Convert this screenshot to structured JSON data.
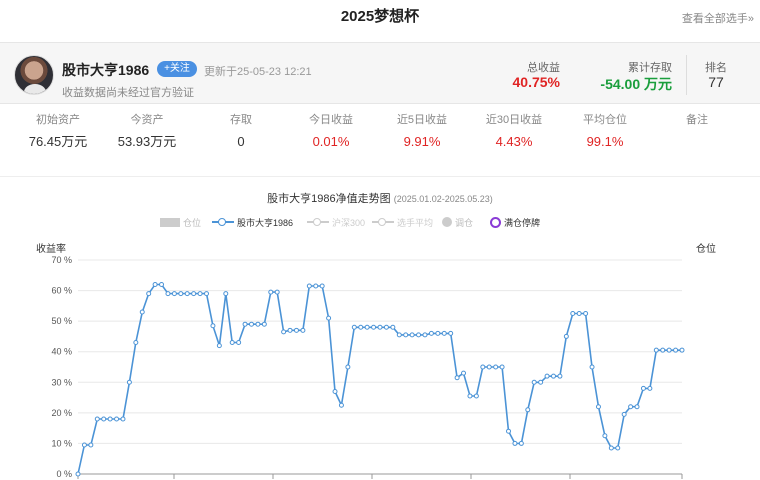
{
  "page": {
    "title": "2025梦想杯",
    "view_all": "查看全部选手»"
  },
  "profile": {
    "name": "股市大亨1986",
    "follow_label": "+关注",
    "updated": "更新于25-05-23 12:21",
    "note": "收益数据尚未经过官方验证",
    "total_return_label": "总收益",
    "total_return_value": "40.75%",
    "cumulative_label": "累计存取",
    "cumulative_value": "-54.00 万元",
    "rank_label": "排名",
    "rank_value": "77"
  },
  "metrics": [
    {
      "label": "初始资产",
      "value": "76.45万元"
    },
    {
      "label": "今资产",
      "value": "53.93万元"
    },
    {
      "label": "存取",
      "value": "0"
    },
    {
      "label": "今日收益",
      "value": "0.01%"
    },
    {
      "label": "近5日收益",
      "value": "9.91%"
    },
    {
      "label": "近30日收益",
      "value": "4.43%"
    },
    {
      "label": "平均仓位",
      "value": "99.1%"
    },
    {
      "label": "备注",
      "value": ""
    }
  ],
  "colors": {
    "accent_blue": "#4a90e2",
    "line_blue": "#4b93d6",
    "positive_red": "#e02424",
    "negative_green": "#1a9e3c",
    "legend_ring": "#8a3bd6"
  },
  "chart_data": {
    "type": "line",
    "title": "股市大亨1986净值走势图",
    "date_range": "(2025.01.02-2025.05.23)",
    "ylabel": "收益率",
    "y2label": "仓位",
    "ylim": [
      0,
      70
    ],
    "yticks": [
      "0 %",
      "10 %",
      "20 %",
      "30 %",
      "40 %",
      "50 %",
      "60 %",
      "70 %"
    ],
    "legend": [
      {
        "label": "仓位",
        "icon": "box-swatch",
        "active": false
      },
      {
        "label": "股市大亨1986",
        "icon": "line-dot-swatch",
        "active": true
      },
      {
        "label": "沪深300",
        "icon": "line-dot-swatch",
        "active": false
      },
      {
        "label": "选手平均",
        "icon": "line-dot-swatch",
        "active": false
      },
      {
        "label": "调仓",
        "icon": "dot-swatch",
        "active": false
      },
      {
        "label": "满仓停牌",
        "icon": "ring-swatch",
        "active": true
      }
    ],
    "series": [
      {
        "name": "股市大亨1986",
        "values": [
          0,
          9.5,
          9.5,
          18,
          18,
          18,
          18,
          18,
          30,
          43,
          53,
          59,
          62,
          62,
          59,
          59,
          59,
          59,
          59,
          59,
          59,
          48.5,
          42,
          59,
          43,
          43,
          49,
          49,
          49,
          49,
          59.5,
          59.5,
          46.5,
          47,
          47,
          47,
          61.5,
          61.5,
          61.5,
          51,
          27,
          22.5,
          35,
          48,
          48,
          48,
          48,
          48,
          48,
          48,
          45.5,
          45.5,
          45.5,
          45.5,
          45.5,
          46,
          46,
          46,
          46,
          31.5,
          33,
          25.5,
          25.5,
          35,
          35,
          35,
          35,
          14,
          10,
          10,
          21,
          30,
          30,
          32,
          32,
          32,
          45,
          52.5,
          52.5,
          52.5,
          35,
          22,
          12.5,
          8.5,
          8.5,
          19.5,
          22,
          22,
          28,
          28,
          40.5,
          40.5,
          40.5,
          40.5,
          40.5
        ]
      }
    ]
  }
}
